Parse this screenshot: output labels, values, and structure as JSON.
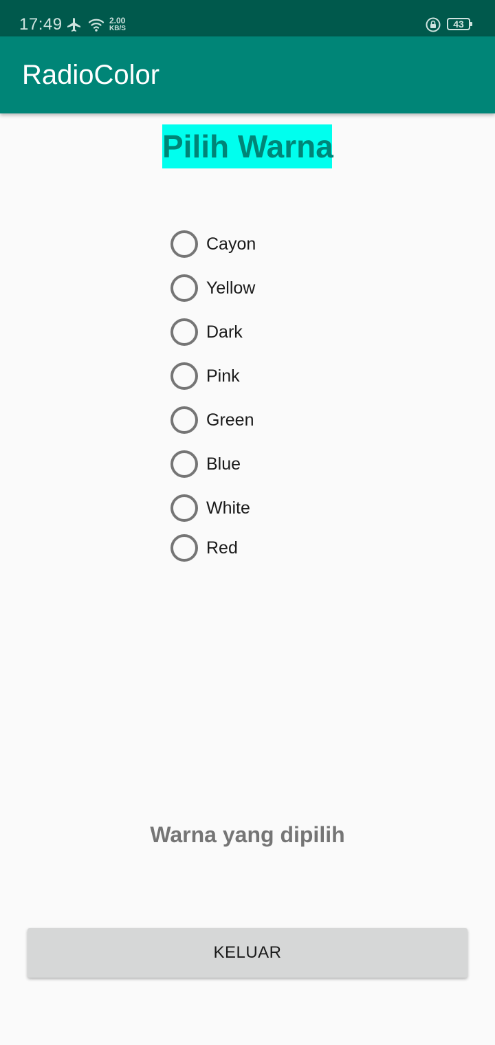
{
  "status_bar": {
    "time": "17:49",
    "net_speed_value": "2.00",
    "net_speed_unit": "KB/S",
    "battery": "43",
    "icons": [
      "airplane-icon",
      "wifi-icon",
      "lock-icon",
      "battery-icon"
    ]
  },
  "app_bar": {
    "title": "RadioColor"
  },
  "heading": {
    "text": "Pilih Warna",
    "background": "#00ffee",
    "color": "#008577"
  },
  "radio_options": [
    {
      "label": "Cayon",
      "checked": false
    },
    {
      "label": "Yellow",
      "checked": false
    },
    {
      "label": "Dark",
      "checked": false
    },
    {
      "label": "Pink",
      "checked": false
    },
    {
      "label": "Green",
      "checked": false
    },
    {
      "label": "Blue",
      "checked": false
    },
    {
      "label": "White",
      "checked": false
    },
    {
      "label": "Red",
      "checked": false
    }
  ],
  "selected_text": "Warna yang dipilih",
  "exit_button": {
    "label": "KELUAR"
  },
  "colors": {
    "primary": "#008577",
    "primary_dark": "#00594c",
    "background": "#fafafa",
    "button": "#d6d7d7"
  }
}
